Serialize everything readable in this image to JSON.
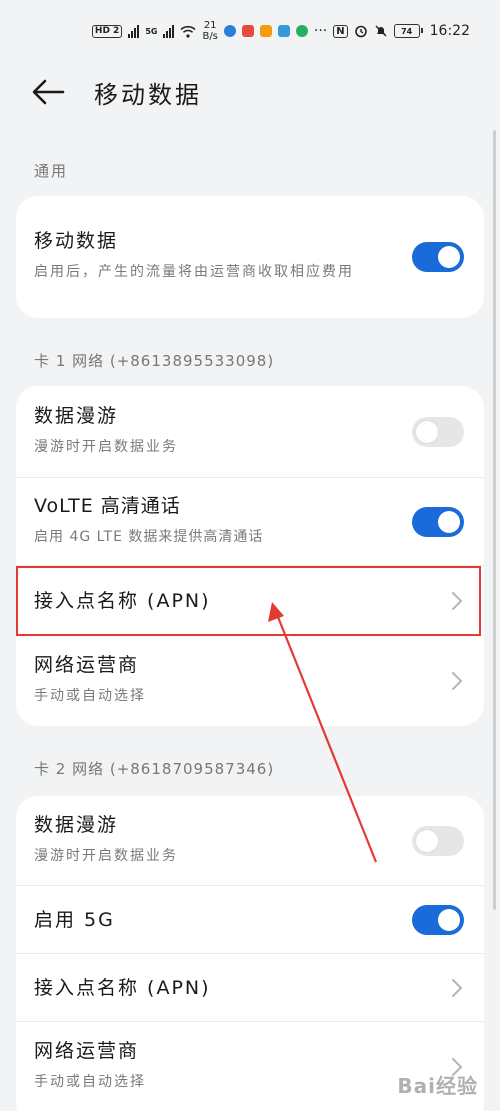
{
  "status_bar": {
    "hd_label": "HD 2",
    "net_label": "5G",
    "rate_value": "21",
    "rate_unit": "B/s",
    "battery": "74",
    "time": "16:22"
  },
  "header": {
    "title": "移动数据"
  },
  "sections": {
    "general_label": "通用",
    "sim1_label": "卡 1 网络 (+8613895533098)",
    "sim2_label": "卡 2 网络 (+8618709587346)"
  },
  "general": {
    "mobile_data_title": "移动数据",
    "mobile_data_sub": "启用后，产生的流量将由运营商收取相应费用",
    "mobile_data_on": true
  },
  "sim1": {
    "roaming_title": "数据漫游",
    "roaming_sub": "漫游时开启数据业务",
    "volte_title": "VoLTE 高清通话",
    "volte_sub": "启用 4G LTE 数据来提供高清通话",
    "apn_title": "接入点名称 (APN)",
    "operator_title": "网络运营商",
    "operator_sub": "手动或自动选择"
  },
  "sim2": {
    "roaming_title": "数据漫游",
    "roaming_sub": "漫游时开启数据业务",
    "enable5g_title": "启用 5G",
    "apn_title": "接入点名称 (APN)",
    "operator_title": "网络运营商",
    "operator_sub": "手动或自动选择"
  },
  "colors": {
    "accent": "#1a6bd9",
    "highlight": "#e53935"
  },
  "watermark": "Bai经验"
}
